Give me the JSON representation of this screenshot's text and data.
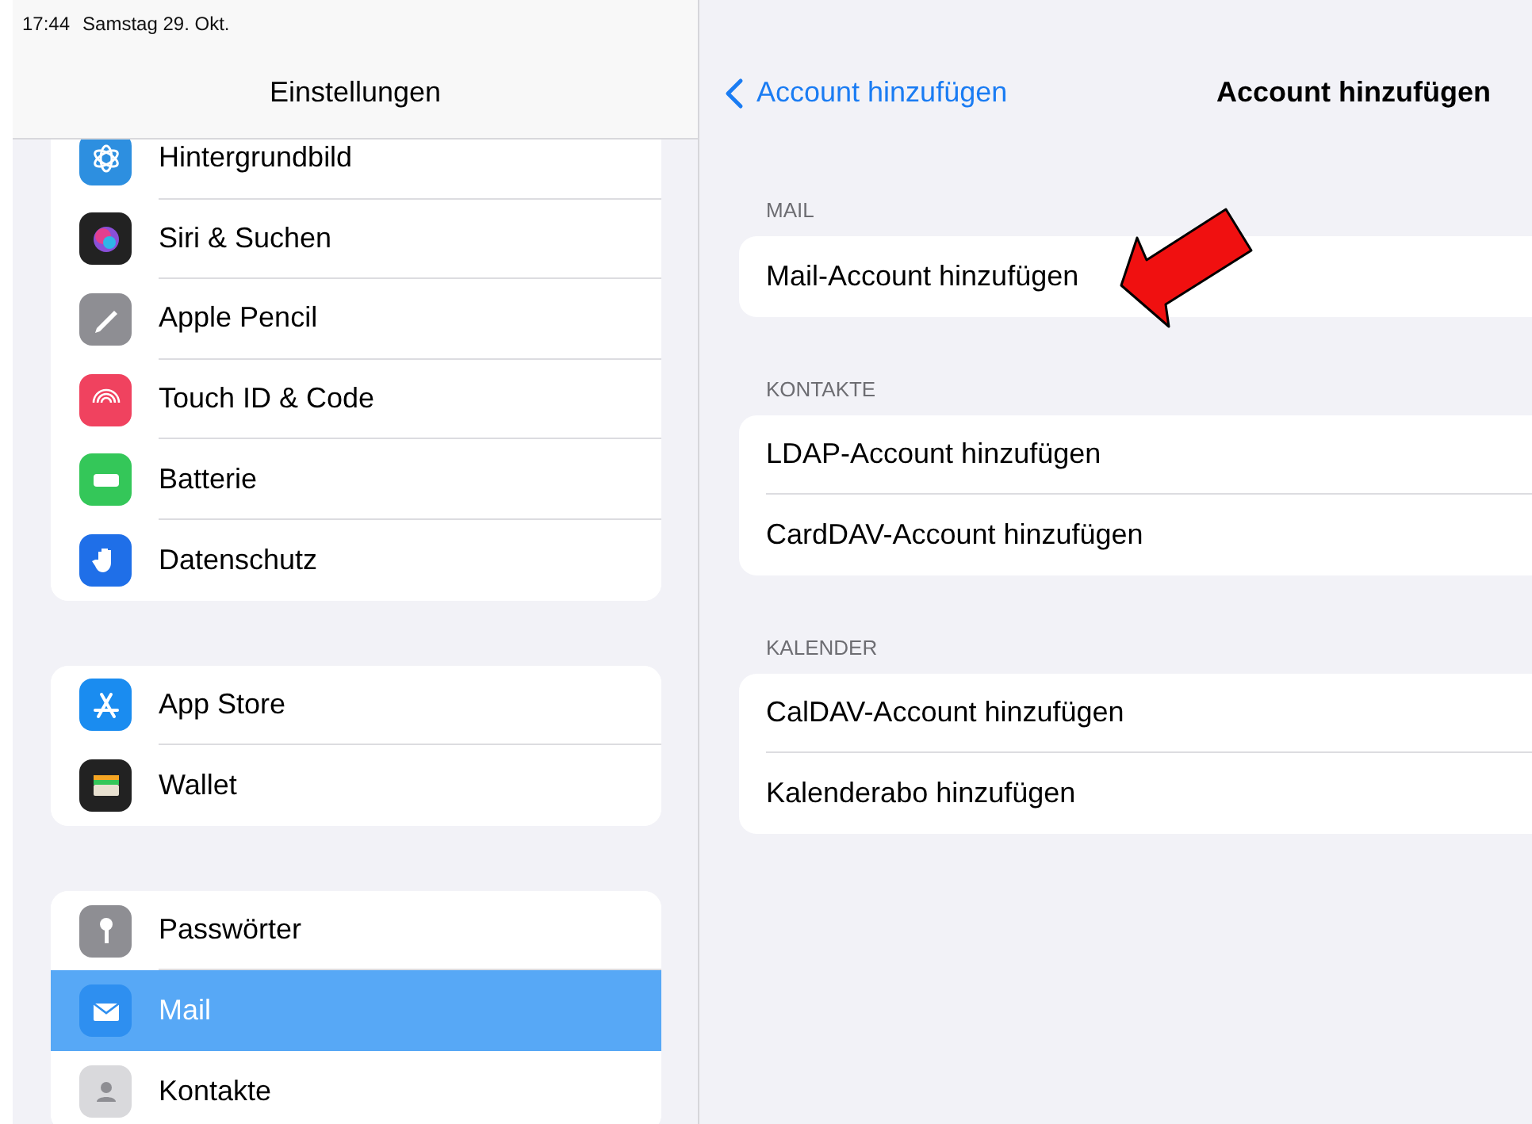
{
  "status_bar": {
    "time": "17:44",
    "date": "Samstag 29. Okt."
  },
  "sidebar": {
    "title": "Einstellungen",
    "groups": [
      {
        "items": [
          {
            "label": "Hintergrundbild",
            "kind": "flower",
            "selected": false
          },
          {
            "label": "Siri & Suchen",
            "kind": "orb",
            "selected": false
          },
          {
            "label": "Apple Pencil",
            "kind": "pencil",
            "selected": false
          },
          {
            "label": "Touch ID & Code",
            "kind": "fingerprint",
            "selected": false
          },
          {
            "label": "Batterie",
            "kind": "battery",
            "selected": false
          },
          {
            "label": "Datenschutz",
            "kind": "hand",
            "selected": false
          }
        ]
      },
      {
        "items": [
          {
            "label": "App Store",
            "kind": "store",
            "selected": false
          },
          {
            "label": "Wallet",
            "kind": "wallet",
            "selected": false
          }
        ]
      },
      {
        "items": [
          {
            "label": "Passwörter",
            "kind": "key",
            "selected": false
          },
          {
            "label": "Mail",
            "kind": "envelope",
            "selected": true
          },
          {
            "label": "Kontakte",
            "kind": "person",
            "selected": false
          }
        ]
      }
    ]
  },
  "detail": {
    "back_label": "Account hinzufügen",
    "title": "Account hinzufügen",
    "sections": [
      {
        "header": "MAIL",
        "items": [
          {
            "label": "Mail-Account hinzufügen"
          }
        ]
      },
      {
        "header": "KONTAKTE",
        "items": [
          {
            "label": "LDAP-Account hinzufügen"
          },
          {
            "label": "CardDAV-Account hinzufügen"
          }
        ]
      },
      {
        "header": "KALENDER",
        "items": [
          {
            "label": "CalDAV-Account hinzufügen"
          },
          {
            "label": "Kalenderabo hinzufügen"
          }
        ]
      }
    ]
  }
}
